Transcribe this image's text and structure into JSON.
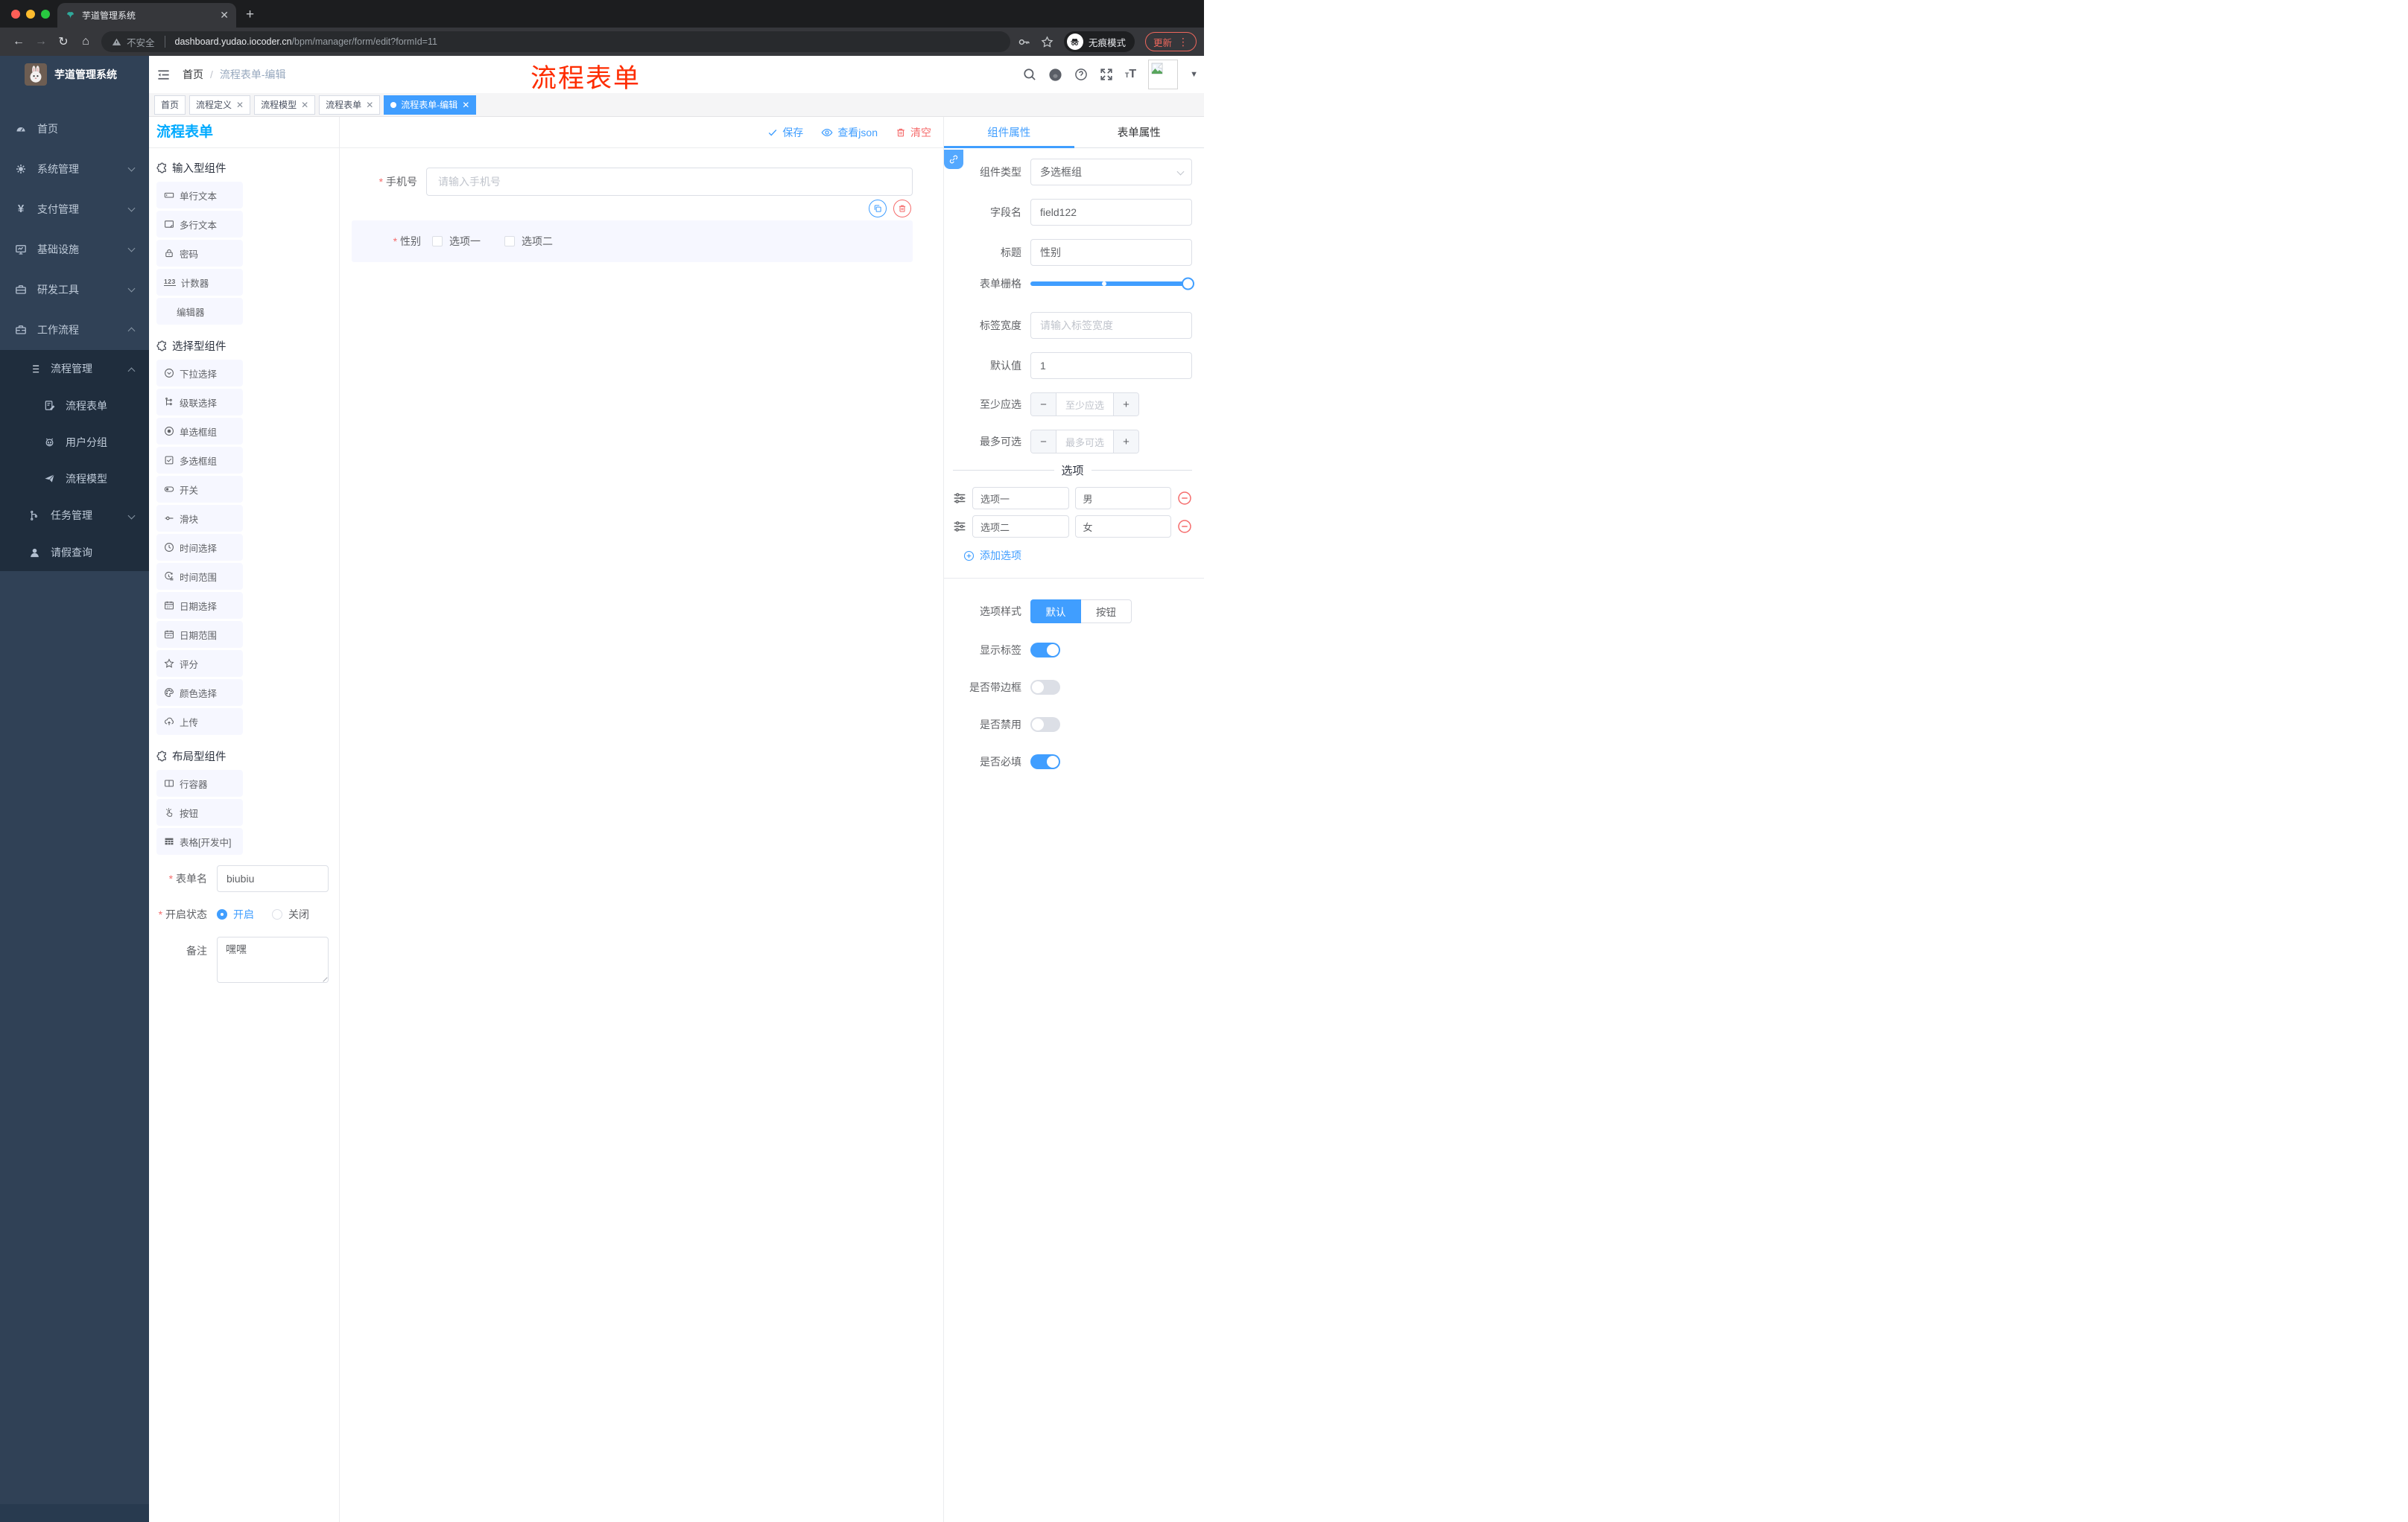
{
  "browser": {
    "tab_title": "芋道管理系统",
    "security_label": "不安全",
    "url_domain": "dashboard.yudao.iocoder.cn",
    "url_path": "/bpm/manager/form/edit?formId=11",
    "incognito_label": "无痕模式",
    "update_label": "更新"
  },
  "sidebar": {
    "app_title": "芋道管理系统",
    "items": [
      {
        "label": "首页"
      },
      {
        "label": "系统管理"
      },
      {
        "label": "支付管理"
      },
      {
        "label": "基础设施"
      },
      {
        "label": "研发工具"
      },
      {
        "label": "工作流程"
      },
      {
        "label": "流程管理"
      },
      {
        "label": "流程表单"
      },
      {
        "label": "用户分组"
      },
      {
        "label": "流程模型"
      },
      {
        "label": "任务管理"
      },
      {
        "label": "请假查询"
      }
    ]
  },
  "header": {
    "breadcrumb_home": "首页",
    "breadcrumb_current": "流程表单-编辑",
    "annotation": "流程表单"
  },
  "tags": [
    "首页",
    "流程定义",
    "流程模型",
    "流程表单",
    "流程表单-编辑"
  ],
  "left_panel": {
    "title": "流程表单",
    "sections": [
      {
        "title": "输入型组件",
        "items": [
          "单行文本",
          "多行文本",
          "密码",
          "计数器",
          "编辑器"
        ]
      },
      {
        "title": "选择型组件",
        "items": [
          "下拉选择",
          "级联选择",
          "单选框组",
          "多选框组",
          "开关",
          "滑块",
          "时间选择",
          "时间范围",
          "日期选择",
          "日期范围",
          "评分",
          "颜色选择",
          "上传"
        ]
      },
      {
        "title": "布局型组件",
        "items": [
          "行容器",
          "按钮",
          "表格[开发中]"
        ]
      }
    ],
    "form": {
      "name_label": "表单名",
      "name_value": "biubiu",
      "status_label": "开启状态",
      "status_on": "开启",
      "status_off": "关闭",
      "remark_label": "备注",
      "remark_value": "嘿嘿"
    }
  },
  "canvas": {
    "save": "保存",
    "view_json": "查看json",
    "clear": "清空",
    "phone_label": "手机号",
    "phone_placeholder": "请输入手机号",
    "gender_label": "性别",
    "gender_options": [
      "选项一",
      "选项二"
    ]
  },
  "right_panel": {
    "tabs": [
      "组件属性",
      "表单属性"
    ],
    "component_type_label": "组件类型",
    "component_type_value": "多选框组",
    "field_name_label": "字段名",
    "field_name_value": "field122",
    "title_label": "标题",
    "title_value": "性别",
    "grid_label": "表单栅格",
    "label_width_label": "标签宽度",
    "label_width_placeholder": "请输入标签宽度",
    "default_label": "默认值",
    "default_value": "1",
    "min_label": "至少应选",
    "min_placeholder": "至少应选",
    "max_label": "最多可选",
    "max_placeholder": "最多可选",
    "options_divider": "选项",
    "options": [
      {
        "label": "选项一",
        "value": "男"
      },
      {
        "label": "选项二",
        "value": "女"
      }
    ],
    "add_option": "添加选项",
    "style_label": "选项样式",
    "style_default": "默认",
    "style_button": "按钮",
    "show_label_label": "显示标签",
    "border_label": "是否带边框",
    "disabled_label": "是否禁用",
    "required_label": "是否必填"
  },
  "colors": {
    "accent": "#409eff",
    "danger": "#f56c6c",
    "annotation_red": "#fe2c00",
    "left_title_blue": "#00aaff",
    "sidebar_bg": "#304156",
    "submenu_bg": "#1f2d3d"
  }
}
